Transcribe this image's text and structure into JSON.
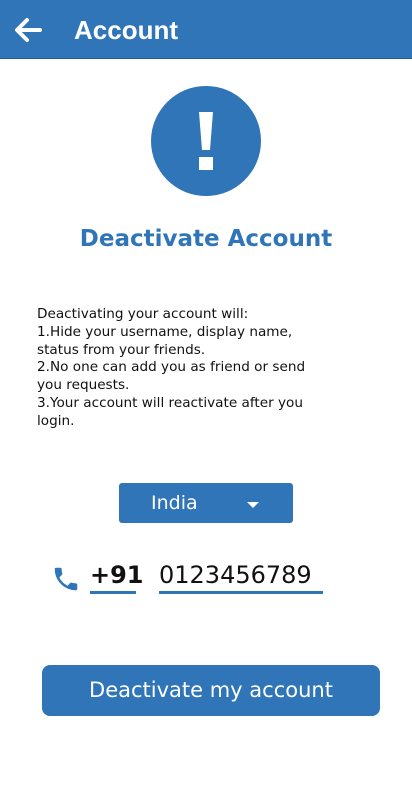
{
  "app_bar": {
    "title": "Account",
    "back_icon": "arrow-left-icon",
    "background": "#2f75b8"
  },
  "alert": {
    "icon": "exclamation-icon",
    "color": "#2f75b8"
  },
  "heading": "Deactivate Account",
  "info": {
    "lines": [
      "Deactivating your account will:",
      "1.Hide your username, display name,",
      "status from your friends.",
      "2.No one can add you as friend or send",
      "you requests.",
      "3.Your account will reactivate after you",
      "login."
    ]
  },
  "country_select": {
    "value": "India",
    "icon": "caret-down-icon"
  },
  "phone": {
    "icon": "phone-icon",
    "country_code": "+91",
    "number": "0123456789"
  },
  "deactivate_button": {
    "label": "Deactivate my account"
  },
  "colors": {
    "accent": "#2f75b8",
    "text": "#111111"
  }
}
